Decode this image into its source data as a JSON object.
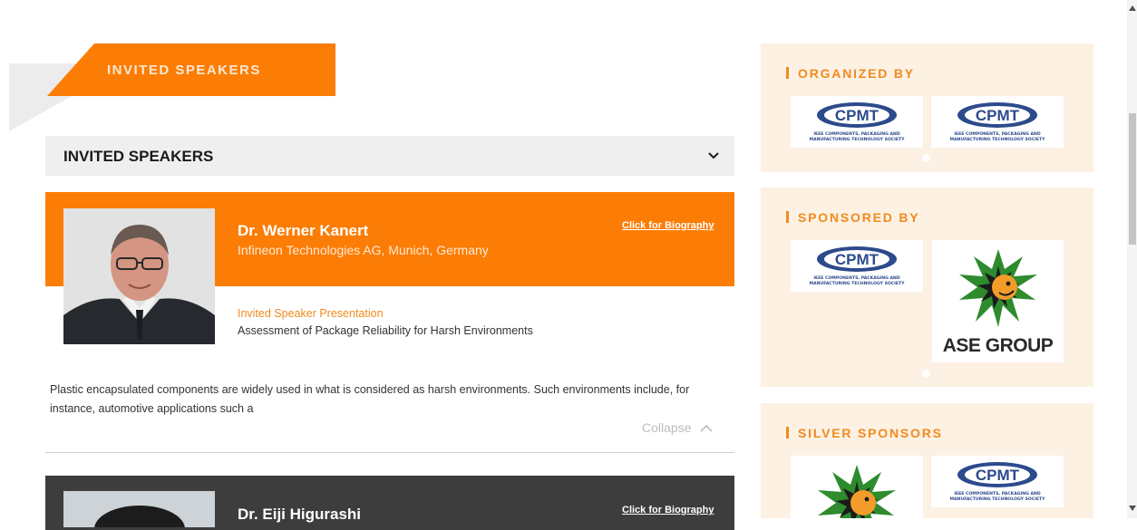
{
  "banner": {
    "label": "INVITED SPEAKERS"
  },
  "accordion": {
    "title": "INVITED SPEAKERS"
  },
  "speakers": [
    {
      "name": "Dr. Werner Kanert",
      "affiliation": "Infineon Technologies AG, Munich, Germany",
      "bio_link": "Click for Biography",
      "presentation_label": "Invited Speaker Presentation",
      "presentation_title": "Assessment of Package Reliability for Harsh Environments",
      "abstract": "Plastic encapsulated components are widely used in what is considered as harsh environments. Such environments include, for instance, automotive applications such a",
      "collapse_label": "Collapse"
    },
    {
      "name": "Dr. Eiji Higurashi",
      "bio_link": "Click for Biography"
    }
  ],
  "sidebar": {
    "organized": {
      "title": "ORGANIZED BY"
    },
    "sponsored": {
      "title": "SPONSORED BY"
    },
    "silver": {
      "title": "SILVER SPONSORS"
    },
    "logos": {
      "cpmt_mark": "CPMT",
      "cpmt_line1": "IEEE COMPONENTS, PACKAGING AND",
      "cpmt_line2": "MANUFACTURING TECHNOLOGY SOCIETY",
      "ase": "ASE GROUP"
    }
  },
  "colors": {
    "accent": "#fb7d06",
    "panel_bg": "#fdf1e4",
    "dark_card": "#3d3d3d",
    "cpmt_blue": "#2c4a8c"
  }
}
